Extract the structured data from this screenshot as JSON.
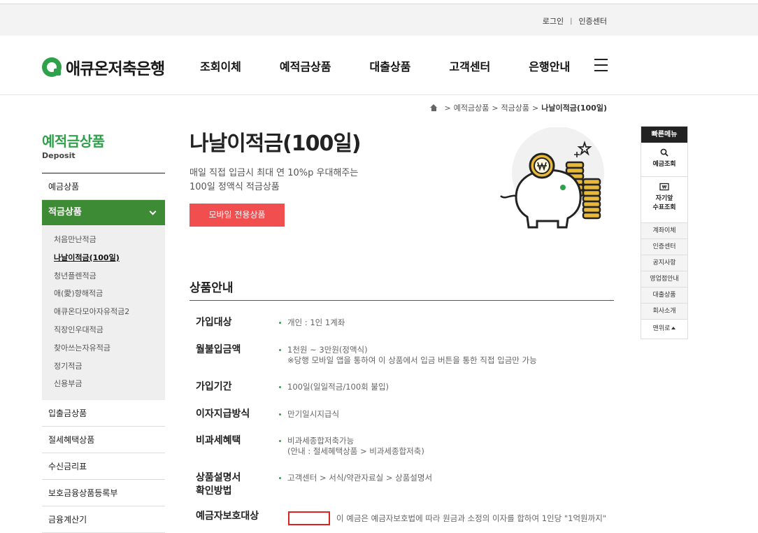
{
  "util": {
    "login": "로그인",
    "sep": "|",
    "cert": "인증센터"
  },
  "brand": {
    "name": "애큐온저축은행",
    "color": "#2fa14a"
  },
  "gnb": [
    "조회이체",
    "예적금상품",
    "대출상품",
    "고객센터",
    "은행안내"
  ],
  "breadcrumb": {
    "items": [
      "예적금상품",
      "적금상품"
    ],
    "current": "나날이적금(100일)",
    "sep": ">"
  },
  "lnb": {
    "title": "예적금상품",
    "subtitle": "Deposit",
    "item_top": "예금상품",
    "active": "적금상품",
    "subs": [
      "처음만난적금",
      "나날이적금(100일)",
      "청년플렌적금",
      "애(愛)향해적금",
      "애큐온다모아자유적금2",
      "직장인우대적금",
      "찾아쓰는자유적금",
      "정기적금",
      "신용부금"
    ],
    "items_bottom": [
      "입출금상품",
      "절세혜택상품",
      "수신금리표",
      "보호금융상품등록부",
      "금융계산기"
    ]
  },
  "product": {
    "title": "나날이적금(100일)",
    "desc1": "매일 직접 입금시 최대 연 10%p 우대해주는",
    "desc2": "100일 정액식 적금상품",
    "mobile_btn": "모바일 전용상품"
  },
  "section": {
    "title": "상품안내"
  },
  "info": {
    "r1": {
      "label": "가입대상",
      "value": "개인 : 1인 1계좌"
    },
    "r2": {
      "label": "월불입금액",
      "value1": "1천원 ~ 3만원(정액식)",
      "value2": "※당행 모바일 앱을 통하여 이 상품에서 입금 버튼을 통한 직접 입금만 가능"
    },
    "r3": {
      "label": "가입기간",
      "value": "100일(일일적금/100회 불입)"
    },
    "r4": {
      "label": "이자지급방식",
      "value": "만기일시지급식"
    },
    "r5": {
      "label": "비과세혜택",
      "value1": "비과세종합저축가능",
      "value2": "(안내 : 절세혜택상품 > 비과세종합저축)"
    },
    "r6": {
      "label1": "상품설명서",
      "label2": "확인방법",
      "value": "고객센터 > 서식/약관자료실 > 상품설명서"
    },
    "r7": {
      "label": "예금자보호대상",
      "value": "이 예금은 예금자보호법에 따라 원금과 소정의 이자를 합하여 1인당 \"1억원까지\""
    }
  },
  "quick": {
    "head": "빠른메뉴",
    "big1": "예금조회",
    "big2a": "자기앞",
    "big2b": "수표조회",
    "items": [
      "계좌이체",
      "인증센터",
      "공지사항",
      "영업점안내",
      "대출상품",
      "회사소개"
    ],
    "top": "맨위로"
  },
  "colors": {
    "accent": "#2fa14a",
    "lnb_active": "#3d8b34",
    "button": "#f14e50"
  }
}
